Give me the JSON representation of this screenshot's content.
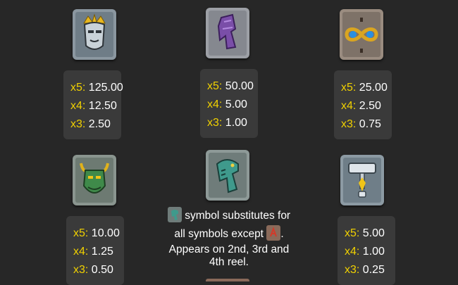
{
  "symbols": [
    {
      "icon": "king-crown-icon",
      "payouts": [
        {
          "mult": "x5:",
          "value": "125.00"
        },
        {
          "mult": "x4:",
          "value": "12.50"
        },
        {
          "mult": "x3:",
          "value": "2.50"
        }
      ]
    },
    {
      "icon": "purple-rune-icon",
      "payouts": [
        {
          "mult": "x5:",
          "value": "50.00"
        },
        {
          "mult": "x4:",
          "value": "5.00"
        },
        {
          "mult": "x3:",
          "value": "1.00"
        }
      ]
    },
    {
      "icon": "infinity-amulet-icon",
      "payouts": [
        {
          "mult": "x5:",
          "value": "25.00"
        },
        {
          "mult": "x4:",
          "value": "2.50"
        },
        {
          "mult": "x3:",
          "value": "0.75"
        }
      ]
    },
    {
      "icon": "horned-helmet-icon",
      "payouts": [
        {
          "mult": "x5:",
          "value": "10.00"
        },
        {
          "mult": "x4:",
          "value": "1.25"
        },
        {
          "mult": "x3:",
          "value": "0.50"
        }
      ]
    },
    {
      "icon": "hammer-icon",
      "payouts": [
        {
          "mult": "x5:",
          "value": "5.00"
        },
        {
          "mult": "x4:",
          "value": "1.00"
        },
        {
          "mult": "x3:",
          "value": "0.25"
        }
      ]
    }
  ],
  "wild": {
    "icon": "serpent-wild-icon",
    "line1": "symbol substitutes for",
    "line2": "all symbols except",
    "line2_end": ".",
    "line3": "Appears on 2nd, 3rd and",
    "line4": "4th reel.",
    "except_icon": "scatter-rune-icon"
  },
  "colors": {
    "background": "#272727",
    "panel": "#3a3a3a",
    "multiplier": "#f1d100",
    "value": "#ffffff"
  }
}
